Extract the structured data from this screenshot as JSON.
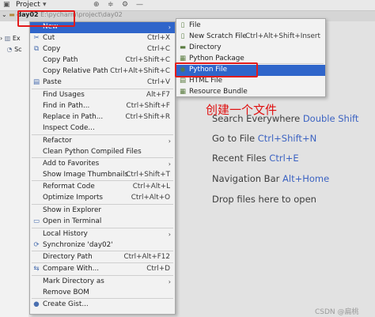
{
  "toolbar": {
    "title": "Project",
    "icons": [
      "folder-icon",
      "chevron-down-icon",
      "target-icon",
      "collapse-icon",
      "gear-icon",
      "minimize-icon"
    ]
  },
  "tree": {
    "root_name": "day02",
    "root_path": "E:\\pycharm\\project\\day02",
    "rows": [
      {
        "label": "Ex",
        "icon": "library-icon"
      },
      {
        "label": "Sc",
        "icon": "scratches-icon"
      }
    ]
  },
  "context_menu": {
    "items": [
      {
        "label": "New",
        "shortcut": "",
        "icon": "",
        "submenu": true,
        "highlighted": true
      },
      {
        "label": "Cut",
        "shortcut": "Ctrl+X",
        "icon": "scissors-icon"
      },
      {
        "label": "Copy",
        "shortcut": "Ctrl+C",
        "icon": "copy-icon"
      },
      {
        "label": "Copy Path",
        "shortcut": "Ctrl+Shift+C",
        "icon": ""
      },
      {
        "label": "Copy Relative Path",
        "shortcut": "Ctrl+Alt+Shift+C",
        "icon": ""
      },
      {
        "label": "Paste",
        "shortcut": "Ctrl+V",
        "icon": "paste-icon"
      },
      {
        "label": "Find Usages",
        "shortcut": "Alt+F7",
        "icon": ""
      },
      {
        "label": "Find in Path...",
        "shortcut": "Ctrl+Shift+F",
        "icon": ""
      },
      {
        "label": "Replace in Path...",
        "shortcut": "Ctrl+Shift+R",
        "icon": ""
      },
      {
        "label": "Inspect Code...",
        "shortcut": "",
        "icon": ""
      },
      {
        "label": "Refactor",
        "shortcut": "",
        "icon": "",
        "submenu": true
      },
      {
        "label": "Clean Python Compiled Files",
        "shortcut": "",
        "icon": ""
      },
      {
        "label": "Add to Favorites",
        "shortcut": "",
        "icon": "",
        "submenu": true
      },
      {
        "label": "Show Image Thumbnails",
        "shortcut": "Ctrl+Shift+T",
        "icon": ""
      },
      {
        "label": "Reformat Code",
        "shortcut": "Ctrl+Alt+L",
        "icon": ""
      },
      {
        "label": "Optimize Imports",
        "shortcut": "Ctrl+Alt+O",
        "icon": ""
      },
      {
        "label": "Show in Explorer",
        "shortcut": "",
        "icon": ""
      },
      {
        "label": "Open in Terminal",
        "shortcut": "",
        "icon": "terminal-icon"
      },
      {
        "label": "Local History",
        "shortcut": "",
        "icon": "",
        "submenu": true
      },
      {
        "label": "Synchronize 'day02'",
        "shortcut": "",
        "icon": "sync-icon"
      },
      {
        "label": "Directory Path",
        "shortcut": "Ctrl+Alt+F12",
        "icon": ""
      },
      {
        "label": "Compare With...",
        "shortcut": "Ctrl+D",
        "icon": "compare-icon"
      },
      {
        "label": "Mark Directory as",
        "shortcut": "",
        "icon": "",
        "submenu": true
      },
      {
        "label": "Remove BOM",
        "shortcut": "",
        "icon": ""
      },
      {
        "label": "Create Gist...",
        "shortcut": "",
        "icon": "github-icon"
      }
    ]
  },
  "submenu": {
    "items": [
      {
        "label": "File",
        "shortcut": "",
        "icon": "file-icon"
      },
      {
        "label": "New Scratch File",
        "shortcut": "Ctrl+Alt+Shift+Insert",
        "icon": "scratch-file-icon"
      },
      {
        "label": "Directory",
        "shortcut": "",
        "icon": "folder-icon"
      },
      {
        "label": "Python Package",
        "shortcut": "",
        "icon": "package-icon"
      },
      {
        "label": "Python File",
        "shortcut": "",
        "icon": "python-icon",
        "highlighted": true
      },
      {
        "label": "HTML File",
        "shortcut": "",
        "icon": "html-icon"
      },
      {
        "label": "Resource Bundle",
        "shortcut": "",
        "icon": "bundle-icon"
      }
    ]
  },
  "annotation": "创建一个文件",
  "editor_hints": [
    {
      "text": "Search Everywhere",
      "shortcut": "Double Shift"
    },
    {
      "text": "Go to File",
      "shortcut": "Ctrl+Shift+N"
    },
    {
      "text": "Recent Files",
      "shortcut": "Ctrl+E"
    },
    {
      "text": "Navigation Bar",
      "shortcut": "Alt+Home"
    },
    {
      "text": "Drop files here to open",
      "shortcut": ""
    }
  ],
  "watermark": "CSDN @扁桃"
}
